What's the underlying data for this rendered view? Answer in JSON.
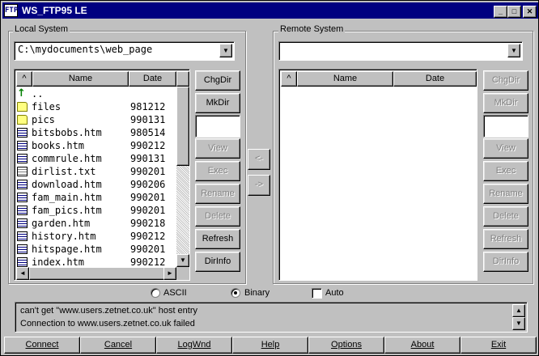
{
  "window": {
    "title": "WS_FTP95 LE",
    "app_icon_text": "FTP",
    "controls": {
      "minimize": "_",
      "maximize": "□",
      "close": "✕"
    }
  },
  "local": {
    "group_label": "Local System",
    "path": "C:\\mydocuments\\web_page",
    "combo_arrow": "▼",
    "columns": {
      "sort": "^",
      "name": "Name",
      "date": "Date"
    },
    "files": [
      {
        "icon": "parent-dir-icon",
        "glyph": "↑",
        "name": "..",
        "date": ""
      },
      {
        "icon": "folder-icon",
        "name": "files",
        "date": "981212"
      },
      {
        "icon": "folder-icon",
        "name": "pics",
        "date": "990131"
      },
      {
        "icon": "html-file-icon",
        "name": "bitsbobs.htm",
        "date": "980514"
      },
      {
        "icon": "html-file-icon",
        "name": "books.htm",
        "date": "990212"
      },
      {
        "icon": "html-file-icon",
        "name": "commrule.htm",
        "date": "990131"
      },
      {
        "icon": "text-file-icon",
        "name": "dirlist.txt",
        "date": "990201"
      },
      {
        "icon": "html-file-icon",
        "name": "download.htm",
        "date": "990206"
      },
      {
        "icon": "html-file-icon",
        "name": "fam_main.htm",
        "date": "990201"
      },
      {
        "icon": "html-file-icon",
        "name": "fam_pics.htm",
        "date": "990201"
      },
      {
        "icon": "html-file-icon",
        "name": "garden.htm",
        "date": "990218"
      },
      {
        "icon": "html-file-icon",
        "name": "history.htm",
        "date": "990212"
      },
      {
        "icon": "html-file-icon",
        "name": "hitspage.htm",
        "date": "990201"
      },
      {
        "icon": "html-file-icon",
        "name": "index.htm",
        "date": "990212"
      }
    ],
    "scroll": {
      "up": "▲",
      "down": "▼",
      "left": "◄",
      "right": "►"
    },
    "buttons": {
      "chgdir": "ChgDir",
      "mkdir": "MkDir",
      "view": "View",
      "exec": "Exec",
      "rename": "Rename",
      "delete": "Delete",
      "refresh": "Refresh",
      "dirinfo": "DirInfo"
    }
  },
  "transfer": {
    "to_local": "<-",
    "to_remote": "->"
  },
  "remote": {
    "group_label": "Remote System",
    "path": "",
    "combo_arrow": "▼",
    "columns": {
      "sort": "^",
      "name": "Name",
      "date": "Date"
    },
    "buttons": {
      "chgdir": "ChgDir",
      "mkdir": "MkDir",
      "view": "View",
      "exec": "Exec",
      "rename": "Rename",
      "delete": "Delete",
      "refresh": "Refresh",
      "dirinfo": "DirInfo"
    }
  },
  "mode": {
    "ascii": "ASCII",
    "binary": "Binary",
    "auto": "Auto",
    "selected": "Binary",
    "auto_checked": false
  },
  "log": {
    "lines": [
      "can't get \"www.users.zetnet.co.uk\" host entry",
      "Connection to www.users.zetnet.co.uk failed"
    ],
    "scroll_up": "▲",
    "scroll_down": "▼"
  },
  "bottom_buttons": {
    "connect": "Connect",
    "cancel": "Cancel",
    "logwnd": "LogWnd",
    "help": "Help",
    "options": "Options",
    "about": "About",
    "exit": "Exit"
  }
}
